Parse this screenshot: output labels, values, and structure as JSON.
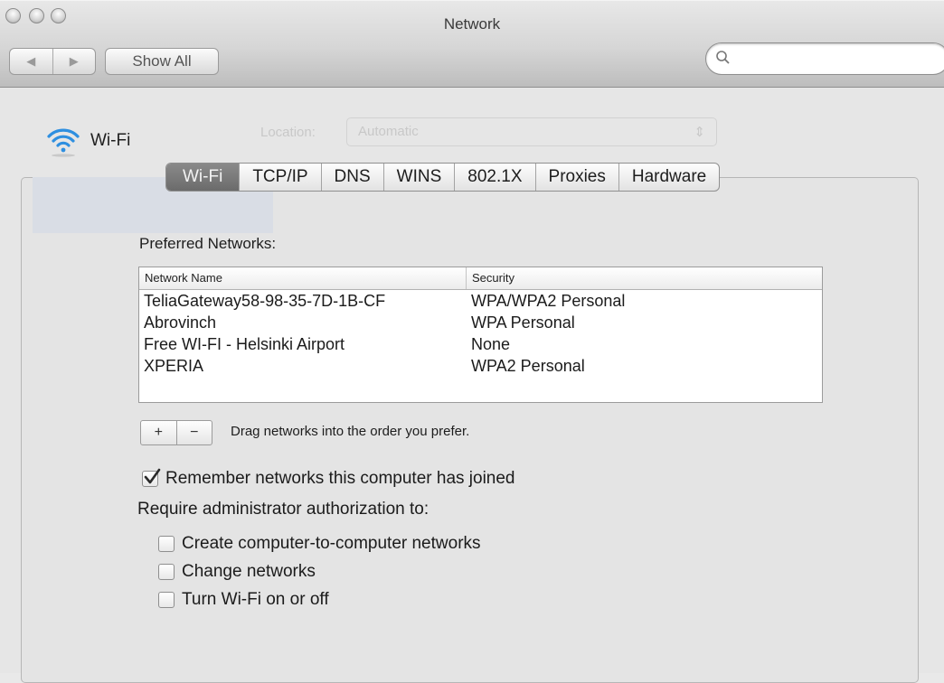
{
  "window": {
    "title": "Network"
  },
  "toolbar": {
    "back_icon": "chevron-left-icon",
    "forward_icon": "chevron-right-icon",
    "show_all_label": "Show All",
    "search_placeholder": ""
  },
  "header": {
    "service_name": "Wi-Fi",
    "location_label": "Location:",
    "location_value": "Automatic"
  },
  "tabs": [
    {
      "label": "Wi-Fi",
      "active": true
    },
    {
      "label": "TCP/IP",
      "active": false
    },
    {
      "label": "DNS",
      "active": false
    },
    {
      "label": "WINS",
      "active": false
    },
    {
      "label": "802.1X",
      "active": false
    },
    {
      "label": "Proxies",
      "active": false
    },
    {
      "label": "Hardware",
      "active": false
    }
  ],
  "preferred": {
    "label": "Preferred Networks:",
    "columns": [
      "Network Name",
      "Security"
    ],
    "rows": [
      [
        "TeliaGateway58-98-35-7D-1B-CF",
        "WPA/WPA2 Personal"
      ],
      [
        "Abrovinch",
        "WPA Personal"
      ],
      [
        "Free WI-FI - Helsinki Airport",
        "None"
      ],
      [
        "XPERIA",
        "WPA2 Personal"
      ]
    ],
    "add_label": "+",
    "remove_label": "−",
    "drag_hint": "Drag networks into the order you prefer."
  },
  "options": {
    "remember": {
      "label": "Remember networks this computer has joined",
      "checked": true
    },
    "require_label": "Require administrator authorization to:",
    "admin": [
      {
        "label": "Create computer-to-computer networks",
        "checked": false
      },
      {
        "label": "Change networks",
        "checked": false
      },
      {
        "label": "Turn Wi-Fi on or off",
        "checked": false
      }
    ]
  },
  "colors": {
    "accent": "#2e6fd6",
    "tab_active": "#7a7a7a"
  }
}
